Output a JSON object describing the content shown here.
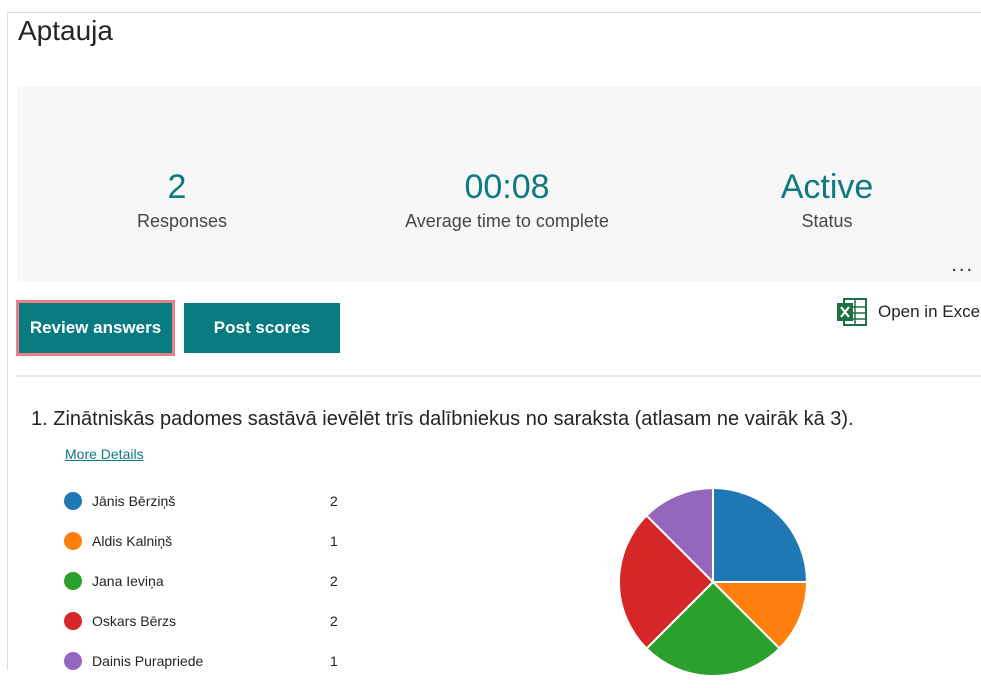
{
  "page": {
    "title": "Aptauja"
  },
  "summary": {
    "responses": {
      "value": "2",
      "label": "Responses"
    },
    "avg_time": {
      "value": "00:08",
      "label": "Average time to complete"
    },
    "status": {
      "value": "Active",
      "label": "Status"
    },
    "more_label": "..."
  },
  "actions": {
    "review_label": "Review answers",
    "post_label": "Post scores",
    "excel_label": "Open in Excel",
    "excel_icon": "excel-icon"
  },
  "question": {
    "title": "1.  Zinātniskās padomes sastāvā ievēlēt trīs dalībniekus no saraksta (atlasam ne vairāk kā 3).",
    "more_details": "More Details",
    "options": [
      {
        "label": "Jānis Bērziņš",
        "count": 2,
        "color": "#1f77b4"
      },
      {
        "label": "Aldis Kalniņš",
        "count": 1,
        "color": "#ff7f0e"
      },
      {
        "label": "Jana Ieviņa",
        "count": 2,
        "color": "#2ca02c"
      },
      {
        "label": "Oskars Bērzs",
        "count": 2,
        "color": "#d62728"
      },
      {
        "label": "Dainis Purapriede",
        "count": 1,
        "color": "#9467bd"
      }
    ]
  },
  "chart_data": {
    "type": "pie",
    "categories": [
      "Jānis Bērziņš",
      "Aldis Kalniņš",
      "Jana Ieviņa",
      "Oskars Bērzs",
      "Dainis Purapriede"
    ],
    "values": [
      2,
      1,
      2,
      2,
      1
    ],
    "colors": [
      "#1f77b4",
      "#ff7f0e",
      "#2ca02c",
      "#d62728",
      "#9467bd"
    ]
  }
}
